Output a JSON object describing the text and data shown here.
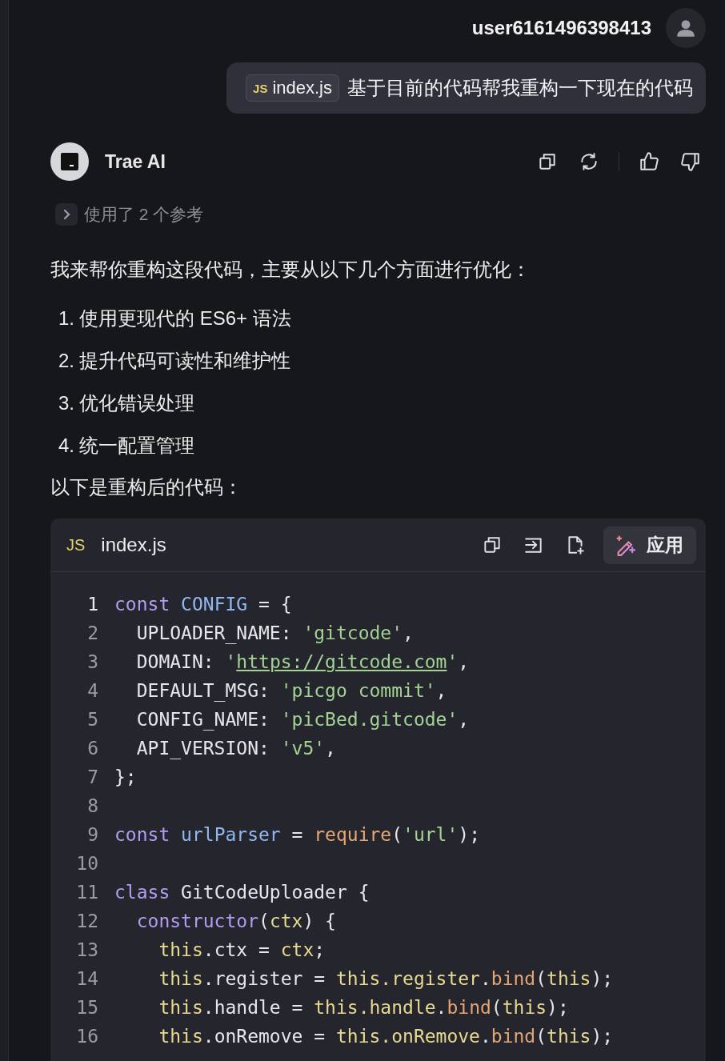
{
  "user": {
    "name": "user6161496398413"
  },
  "user_message": {
    "attachment": {
      "badge": "JS",
      "file": "index.js"
    },
    "text": "基于目前的代码帮我重构一下现在的代码"
  },
  "assistant": {
    "name": "Trae AI",
    "references": {
      "label": "使用了 2 个参考",
      "expanded": false
    },
    "intro": "我来帮你重构这段代码，主要从以下几个方面进行优化：",
    "points": [
      {
        "number": "1.",
        "text": "使用更现代的 ES6+ 语法"
      },
      {
        "number": "2.",
        "text": "提升代码可读性和维护性"
      },
      {
        "number": "3.",
        "text": "优化错误处理"
      },
      {
        "number": "4.",
        "text": "统一配置管理"
      }
    ],
    "outro": "以下是重构后的代码："
  },
  "code_block": {
    "badge": "JS",
    "file": "index.js",
    "apply_label": "应用",
    "lines": [
      {
        "number": "1",
        "tokens": [
          {
            "kind": "kw",
            "text": "const "
          },
          {
            "kind": "def",
            "text": "CONFIG"
          },
          {
            "kind": "plain",
            "text": " = {"
          }
        ]
      },
      {
        "number": "2",
        "tokens": [
          {
            "kind": "plain",
            "text": "  UPLOADER_NAME: "
          },
          {
            "kind": "str",
            "text": "'gitcode'"
          },
          {
            "kind": "plain",
            "text": ","
          }
        ]
      },
      {
        "number": "3",
        "tokens": [
          {
            "kind": "plain",
            "text": "  DOMAIN: "
          },
          {
            "kind": "str",
            "text": "'"
          },
          {
            "kind": "link",
            "text": "https://gitcode.com"
          },
          {
            "kind": "str",
            "text": "'"
          },
          {
            "kind": "plain",
            "text": ","
          }
        ]
      },
      {
        "number": "4",
        "tokens": [
          {
            "kind": "plain",
            "text": "  DEFAULT_MSG: "
          },
          {
            "kind": "str",
            "text": "'picgo commit'"
          },
          {
            "kind": "plain",
            "text": ","
          }
        ]
      },
      {
        "number": "5",
        "tokens": [
          {
            "kind": "plain",
            "text": "  CONFIG_NAME: "
          },
          {
            "kind": "str",
            "text": "'picBed.gitcode'"
          },
          {
            "kind": "plain",
            "text": ","
          }
        ]
      },
      {
        "number": "6",
        "tokens": [
          {
            "kind": "plain",
            "text": "  API_VERSION: "
          },
          {
            "kind": "str",
            "text": "'v5'"
          },
          {
            "kind": "plain",
            "text": ","
          }
        ]
      },
      {
        "number": "7",
        "tokens": [
          {
            "kind": "plain",
            "text": "};"
          }
        ]
      },
      {
        "number": "8"
      },
      {
        "number": "9",
        "tokens": [
          {
            "kind": "kw",
            "text": "const "
          },
          {
            "kind": "def",
            "text": "urlParser"
          },
          {
            "kind": "plain",
            "text": " = "
          },
          {
            "kind": "fn",
            "text": "require"
          },
          {
            "kind": "plain",
            "text": "("
          },
          {
            "kind": "str",
            "text": "'url'"
          },
          {
            "kind": "plain",
            "text": ");"
          }
        ]
      },
      {
        "number": "10"
      },
      {
        "number": "11",
        "tokens": [
          {
            "kind": "kw",
            "text": "class "
          },
          {
            "kind": "plain",
            "text": "GitCodeUploader {"
          }
        ]
      },
      {
        "number": "12",
        "tokens": [
          {
            "kind": "kw",
            "text": "  constructor"
          },
          {
            "kind": "plain",
            "text": "("
          },
          {
            "kind": "this",
            "text": "ctx"
          },
          {
            "kind": "plain",
            "text": ") {"
          }
        ]
      },
      {
        "number": "13",
        "tokens": [
          {
            "kind": "this",
            "text": "    this"
          },
          {
            "kind": "plain",
            "text": ".ctx = "
          },
          {
            "kind": "this",
            "text": "ctx"
          },
          {
            "kind": "plain",
            "text": ";"
          }
        ]
      },
      {
        "number": "14",
        "tokens": [
          {
            "kind": "this",
            "text": "    this"
          },
          {
            "kind": "plain",
            "text": ".register = "
          },
          {
            "kind": "this",
            "text": "this.register"
          },
          {
            "kind": "plain",
            "text": "."
          },
          {
            "kind": "fn",
            "text": "bind"
          },
          {
            "kind": "plain",
            "text": "("
          },
          {
            "kind": "this",
            "text": "this"
          },
          {
            "kind": "plain",
            "text": ");"
          }
        ]
      },
      {
        "number": "15",
        "tokens": [
          {
            "kind": "this",
            "text": "    this"
          },
          {
            "kind": "plain",
            "text": ".handle = "
          },
          {
            "kind": "this",
            "text": "this.handle"
          },
          {
            "kind": "plain",
            "text": "."
          },
          {
            "kind": "fn",
            "text": "bind"
          },
          {
            "kind": "plain",
            "text": "("
          },
          {
            "kind": "this",
            "text": "this"
          },
          {
            "kind": "plain",
            "text": ");"
          }
        ]
      },
      {
        "number": "16",
        "tokens": [
          {
            "kind": "this",
            "text": "    this"
          },
          {
            "kind": "plain",
            "text": ".onRemove = "
          },
          {
            "kind": "this",
            "text": "this.onRemove"
          },
          {
            "kind": "plain",
            "text": "."
          },
          {
            "kind": "fn",
            "text": "bind"
          },
          {
            "kind": "plain",
            "text": "("
          },
          {
            "kind": "this",
            "text": "this"
          },
          {
            "kind": "plain",
            "text": ");"
          }
        ]
      }
    ]
  }
}
